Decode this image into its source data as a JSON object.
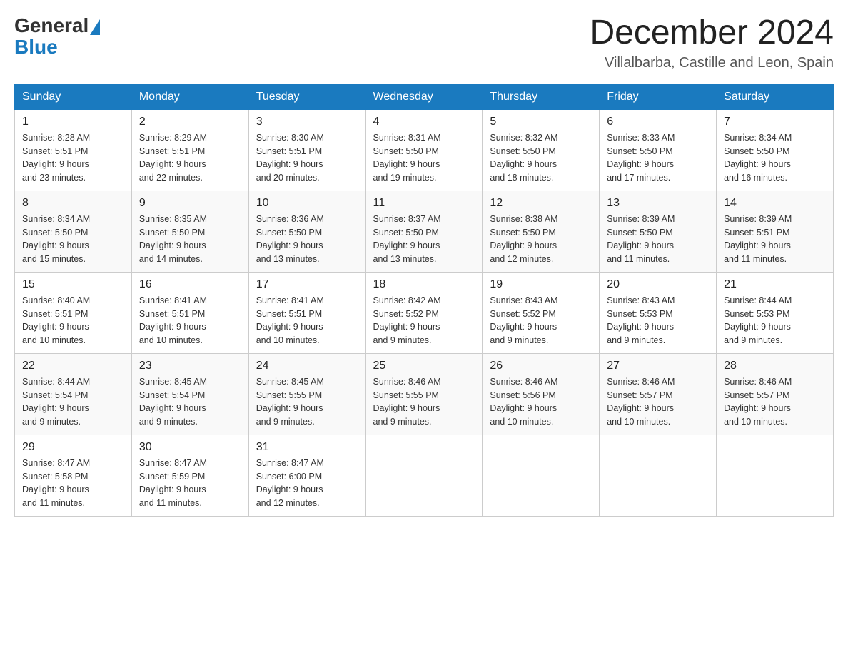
{
  "header": {
    "logo_general": "General",
    "logo_blue": "Blue",
    "month_year": "December 2024",
    "location": "Villalbarba, Castille and Leon, Spain"
  },
  "columns": [
    "Sunday",
    "Monday",
    "Tuesday",
    "Wednesday",
    "Thursday",
    "Friday",
    "Saturday"
  ],
  "weeks": [
    [
      {
        "day": "1",
        "sunrise": "8:28 AM",
        "sunset": "5:51 PM",
        "daylight": "9 hours and 23 minutes."
      },
      {
        "day": "2",
        "sunrise": "8:29 AM",
        "sunset": "5:51 PM",
        "daylight": "9 hours and 22 minutes."
      },
      {
        "day": "3",
        "sunrise": "8:30 AM",
        "sunset": "5:51 PM",
        "daylight": "9 hours and 20 minutes."
      },
      {
        "day": "4",
        "sunrise": "8:31 AM",
        "sunset": "5:50 PM",
        "daylight": "9 hours and 19 minutes."
      },
      {
        "day": "5",
        "sunrise": "8:32 AM",
        "sunset": "5:50 PM",
        "daylight": "9 hours and 18 minutes."
      },
      {
        "day": "6",
        "sunrise": "8:33 AM",
        "sunset": "5:50 PM",
        "daylight": "9 hours and 17 minutes."
      },
      {
        "day": "7",
        "sunrise": "8:34 AM",
        "sunset": "5:50 PM",
        "daylight": "9 hours and 16 minutes."
      }
    ],
    [
      {
        "day": "8",
        "sunrise": "8:34 AM",
        "sunset": "5:50 PM",
        "daylight": "9 hours and 15 minutes."
      },
      {
        "day": "9",
        "sunrise": "8:35 AM",
        "sunset": "5:50 PM",
        "daylight": "9 hours and 14 minutes."
      },
      {
        "day": "10",
        "sunrise": "8:36 AM",
        "sunset": "5:50 PM",
        "daylight": "9 hours and 13 minutes."
      },
      {
        "day": "11",
        "sunrise": "8:37 AM",
        "sunset": "5:50 PM",
        "daylight": "9 hours and 13 minutes."
      },
      {
        "day": "12",
        "sunrise": "8:38 AM",
        "sunset": "5:50 PM",
        "daylight": "9 hours and 12 minutes."
      },
      {
        "day": "13",
        "sunrise": "8:39 AM",
        "sunset": "5:50 PM",
        "daylight": "9 hours and 11 minutes."
      },
      {
        "day": "14",
        "sunrise": "8:39 AM",
        "sunset": "5:51 PM",
        "daylight": "9 hours and 11 minutes."
      }
    ],
    [
      {
        "day": "15",
        "sunrise": "8:40 AM",
        "sunset": "5:51 PM",
        "daylight": "9 hours and 10 minutes."
      },
      {
        "day": "16",
        "sunrise": "8:41 AM",
        "sunset": "5:51 PM",
        "daylight": "9 hours and 10 minutes."
      },
      {
        "day": "17",
        "sunrise": "8:41 AM",
        "sunset": "5:51 PM",
        "daylight": "9 hours and 10 minutes."
      },
      {
        "day": "18",
        "sunrise": "8:42 AM",
        "sunset": "5:52 PM",
        "daylight": "9 hours and 9 minutes."
      },
      {
        "day": "19",
        "sunrise": "8:43 AM",
        "sunset": "5:52 PM",
        "daylight": "9 hours and 9 minutes."
      },
      {
        "day": "20",
        "sunrise": "8:43 AM",
        "sunset": "5:53 PM",
        "daylight": "9 hours and 9 minutes."
      },
      {
        "day": "21",
        "sunrise": "8:44 AM",
        "sunset": "5:53 PM",
        "daylight": "9 hours and 9 minutes."
      }
    ],
    [
      {
        "day": "22",
        "sunrise": "8:44 AM",
        "sunset": "5:54 PM",
        "daylight": "9 hours and 9 minutes."
      },
      {
        "day": "23",
        "sunrise": "8:45 AM",
        "sunset": "5:54 PM",
        "daylight": "9 hours and 9 minutes."
      },
      {
        "day": "24",
        "sunrise": "8:45 AM",
        "sunset": "5:55 PM",
        "daylight": "9 hours and 9 minutes."
      },
      {
        "day": "25",
        "sunrise": "8:46 AM",
        "sunset": "5:55 PM",
        "daylight": "9 hours and 9 minutes."
      },
      {
        "day": "26",
        "sunrise": "8:46 AM",
        "sunset": "5:56 PM",
        "daylight": "9 hours and 10 minutes."
      },
      {
        "day": "27",
        "sunrise": "8:46 AM",
        "sunset": "5:57 PM",
        "daylight": "9 hours and 10 minutes."
      },
      {
        "day": "28",
        "sunrise": "8:46 AM",
        "sunset": "5:57 PM",
        "daylight": "9 hours and 10 minutes."
      }
    ],
    [
      {
        "day": "29",
        "sunrise": "8:47 AM",
        "sunset": "5:58 PM",
        "daylight": "9 hours and 11 minutes."
      },
      {
        "day": "30",
        "sunrise": "8:47 AM",
        "sunset": "5:59 PM",
        "daylight": "9 hours and 11 minutes."
      },
      {
        "day": "31",
        "sunrise": "8:47 AM",
        "sunset": "6:00 PM",
        "daylight": "9 hours and 12 minutes."
      },
      null,
      null,
      null,
      null
    ]
  ],
  "labels": {
    "sunrise": "Sunrise:",
    "sunset": "Sunset:",
    "daylight": "Daylight:"
  }
}
